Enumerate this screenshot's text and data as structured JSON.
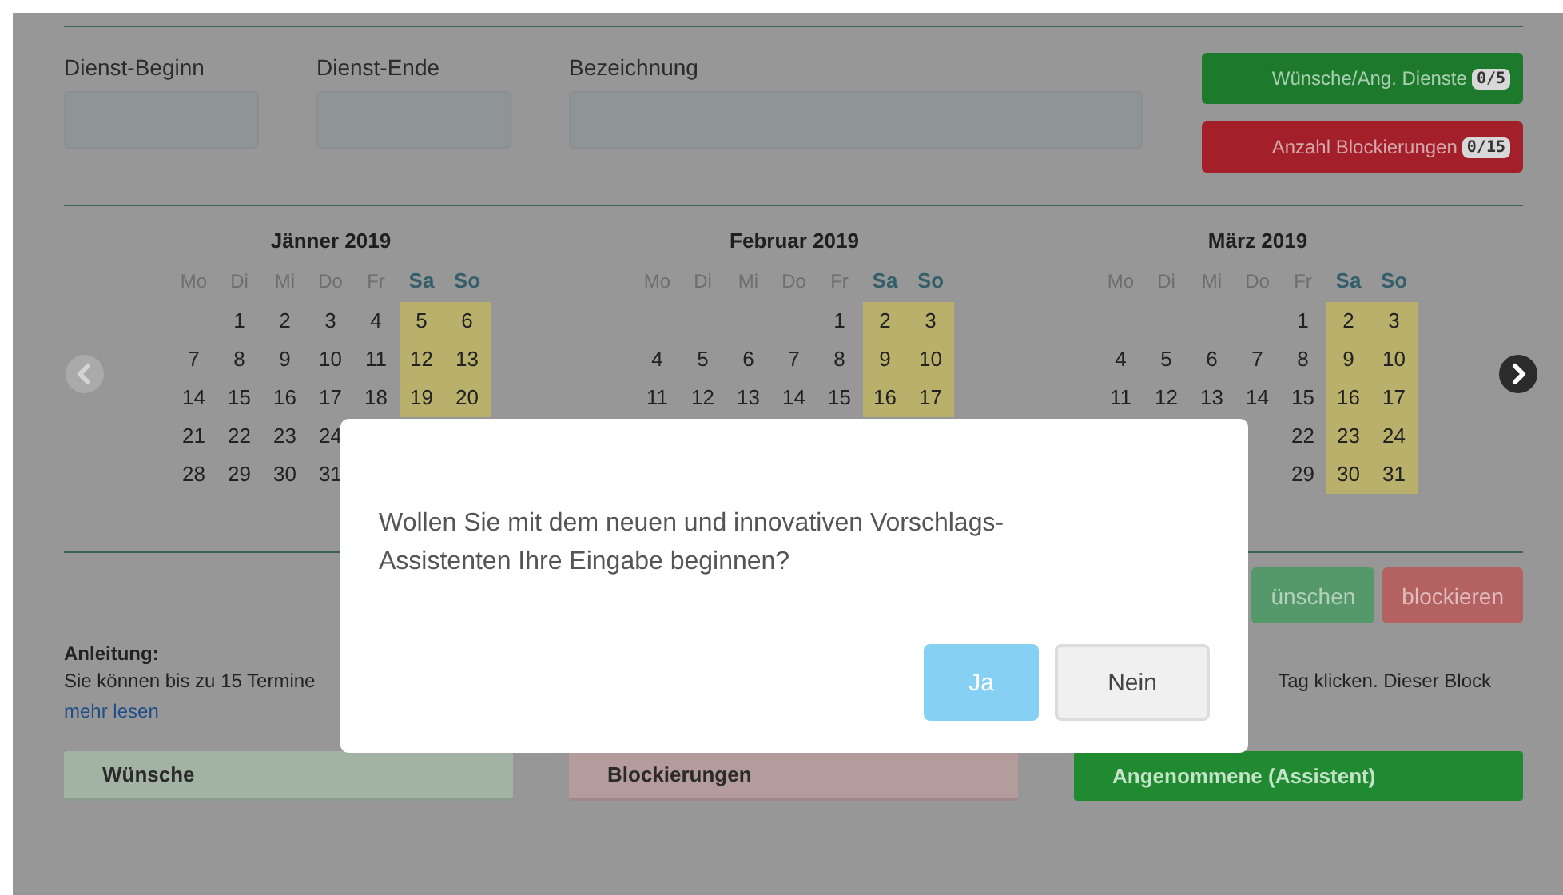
{
  "fields": [
    {
      "label": "Dienst-Beginn",
      "kind": "time"
    },
    {
      "label": "Dienst-Ende",
      "kind": "time"
    },
    {
      "label": "Bezeichnung",
      "kind": "text"
    }
  ],
  "counters": [
    {
      "label": "Wünsche/Ang. Dienste",
      "badge": "0/5",
      "kind": "success"
    },
    {
      "label": "Anzahl Blockierungen",
      "badge": "0/15",
      "kind": "danger"
    }
  ],
  "calendar": {
    "prev": {
      "disabled": true
    },
    "next": {
      "disabled": false
    },
    "months": [
      {
        "title": "Jänner 2019",
        "weekdays": [
          {
            "label": "Mo",
            "weekend": false
          },
          {
            "label": "Di",
            "weekend": false
          },
          {
            "label": "Mi",
            "weekend": false
          },
          {
            "label": "Do",
            "weekend": false
          },
          {
            "label": "Fr",
            "weekend": false
          },
          {
            "label": "Sa",
            "weekend": true
          },
          {
            "label": "So",
            "weekend": true
          }
        ],
        "weeks": [
          {
            "kind": "tail",
            "days": [
              "1",
              "2",
              "3",
              "4",
              "5",
              "6"
            ]
          },
          {
            "kind": "head",
            "days": [
              "7",
              "8",
              "9",
              "10",
              "11",
              "12",
              "13"
            ]
          },
          {
            "kind": "head",
            "days": [
              "14",
              "15",
              "16",
              "17",
              "18",
              "19",
              "20"
            ]
          },
          {
            "kind": "head",
            "days": [
              "21",
              "22",
              "23",
              "24"
            ]
          },
          {
            "kind": "head",
            "days": [
              "28",
              "29",
              "30",
              "31"
            ]
          }
        ]
      },
      {
        "title": "Februar 2019",
        "weekdays": [
          {
            "label": "Mo",
            "weekend": false
          },
          {
            "label": "Di",
            "weekend": false
          },
          {
            "label": "Mi",
            "weekend": false
          },
          {
            "label": "Do",
            "weekend": false
          },
          {
            "label": "Fr",
            "weekend": false
          },
          {
            "label": "Sa",
            "weekend": true
          },
          {
            "label": "So",
            "weekend": true
          }
        ],
        "weeks": [
          {
            "kind": "tail",
            "days": [
              "1",
              "2",
              "3"
            ]
          },
          {
            "kind": "head",
            "days": [
              "4",
              "5",
              "6",
              "7",
              "8",
              "9",
              "10"
            ]
          },
          {
            "kind": "head",
            "days": [
              "11",
              "12",
              "13",
              "14",
              "15",
              "16",
              "17"
            ]
          }
        ]
      },
      {
        "title": "März 2019",
        "weekdays": [
          {
            "label": "Mo",
            "weekend": false
          },
          {
            "label": "Di",
            "weekend": false
          },
          {
            "label": "Mi",
            "weekend": false
          },
          {
            "label": "Do",
            "weekend": false
          },
          {
            "label": "Fr",
            "weekend": false
          },
          {
            "label": "Sa",
            "weekend": true
          },
          {
            "label": "So",
            "weekend": true
          }
        ],
        "weeks": [
          {
            "kind": "tail",
            "days": [
              "1",
              "2",
              "3"
            ]
          },
          {
            "kind": "head",
            "days": [
              "4",
              "5",
              "6",
              "7",
              "8",
              "9",
              "10"
            ]
          },
          {
            "kind": "head",
            "days": [
              "11",
              "12",
              "13",
              "14",
              "15",
              "16",
              "17"
            ]
          },
          {
            "kind": "tail",
            "days": [
              "22",
              "23",
              "24"
            ]
          },
          {
            "kind": "tail",
            "days": [
              "29",
              "30",
              "31"
            ]
          }
        ]
      }
    ]
  },
  "actions": [
    {
      "label": "ünschen",
      "kind": "success"
    },
    {
      "label": "blockieren",
      "kind": "danger"
    }
  ],
  "instructions": {
    "heading": "Anleitung:",
    "text_left": "Sie können bis zu 15 Termine",
    "text_right": "Tag klicken. Dieser Block",
    "link": "mehr lesen"
  },
  "legend": [
    {
      "label": "Wünsche",
      "kind": "wish"
    },
    {
      "label": "Blockierungen",
      "kind": "block"
    },
    {
      "label": "Angenommene (Assistent)",
      "kind": "accepted"
    }
  ],
  "dialog": {
    "message": "Wollen Sie mit dem neuen und innovativen Vorschlags-Assistenten Ihre Eingabe beginnen?",
    "buttons": [
      {
        "label": "Ja",
        "kind": "primary"
      },
      {
        "label": "Nein",
        "kind": "default"
      }
    ]
  }
}
